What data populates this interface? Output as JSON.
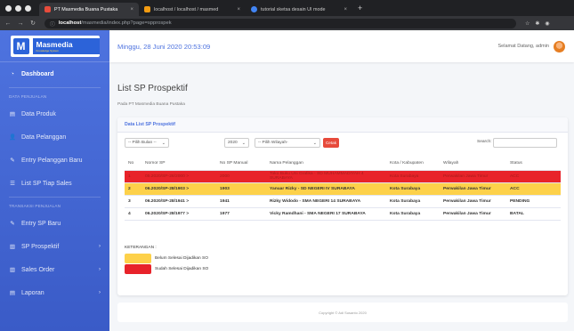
{
  "browser": {
    "tabs": [
      {
        "title": "PT Masmedia Buana Pustaka",
        "color": "#e74c3c"
      },
      {
        "title": "localhost / localhost / masmed",
        "color": "#f39c12"
      },
      {
        "title": "tutorial sketsa desain UI mode",
        "color": "#4285f4"
      }
    ],
    "url_host": "localhost",
    "url_path": "/masmedia/index.php?page=spprospek",
    "new_tab": "+"
  },
  "sidebar": {
    "brand": "Masmedia",
    "brand_tagline": "Knowledge System",
    "dashboard": "Dashboard",
    "heading_data": "DATA PENJUALAN",
    "items": [
      {
        "label": "Data Produk",
        "icon": "▤"
      },
      {
        "label": "Data Pelanggan",
        "icon": "👤"
      },
      {
        "label": "Entry Pelanggan Baru",
        "icon": "✎"
      },
      {
        "label": "List SP Tiap Sales",
        "icon": "☰"
      }
    ],
    "heading_trans": "TRANSAKSI PENJUALAN",
    "items2": [
      {
        "label": "Entry SP Baru",
        "icon": "✎"
      },
      {
        "label": "SP Prospektif",
        "icon": "▥"
      },
      {
        "label": "Sales Order",
        "icon": "▥"
      },
      {
        "label": "Laporan",
        "icon": "▤"
      }
    ]
  },
  "topbar": {
    "datetime": "Minggu, 28 Juni 2020 20:53:09",
    "welcome": "Selamat Datang, admin"
  },
  "page": {
    "title": "List SP Prospektif",
    "subtitle": "Pada PT Masmedia Buana Pustaka",
    "card_title": "Data List SP Prospektif"
  },
  "filters": {
    "month": "-- Pilih Bulan --",
    "year": "2020",
    "region": "-- Pilih Wilayah-",
    "print": "Cetak",
    "search_label": "Search:"
  },
  "table": {
    "headers": [
      "No",
      "Nomor SP",
      "No SP Manual",
      "Nama Pelanggan",
      "Kota / Kabupaten",
      "Wilayah",
      "Status"
    ],
    "rows": [
      {
        "no": "1",
        "nomor": "05.2020/SP-28/2000 >",
        "manual": "2000",
        "nama": "Toko Buku Uni Grafika - SD MUHAMMADIYAH 4 SURABAYA",
        "kota": "Kota Surabaya",
        "wilayah": "Perwakilan Jawa Timur",
        "status": "ACC"
      },
      {
        "no": "2",
        "nomor": "06.2020/SP-28/1903 >",
        "manual": "1903",
        "nama": "Yanuar Rizky - SD NEGERI IV SURABAYA",
        "kota": "Kota Surabaya",
        "wilayah": "Perwakilan Jawa Timur",
        "status": "ACC"
      },
      {
        "no": "3",
        "nomor": "06.2020/SP-28/1941 >",
        "manual": "1941",
        "nama": "Rizky Widodo - SMA NEGERI 14 SURABAYA",
        "kota": "Kota Surabaya",
        "wilayah": "Perwakilan Jawa Timur",
        "status": "PENDING"
      },
      {
        "no": "4",
        "nomor": "06.2020/SP-28/1977 >",
        "manual": "1977",
        "nama": "Vicky Ramdhani - SMA NEGERI 17 SURABAYA",
        "kota": "Kota Surabaya",
        "wilayah": "Perwakilan Jawa Timur",
        "status": "BATAL"
      }
    ]
  },
  "legend": {
    "title": "KETERANGAN :",
    "items": [
      {
        "label": "Belum Selesai Dijadikan SO",
        "color": "#fdd14a"
      },
      {
        "label": "Sudah Selesai Dijadikan SO",
        "color": "#e8232a"
      }
    ]
  },
  "footer": "Copyright © Adi Susanto 2020"
}
